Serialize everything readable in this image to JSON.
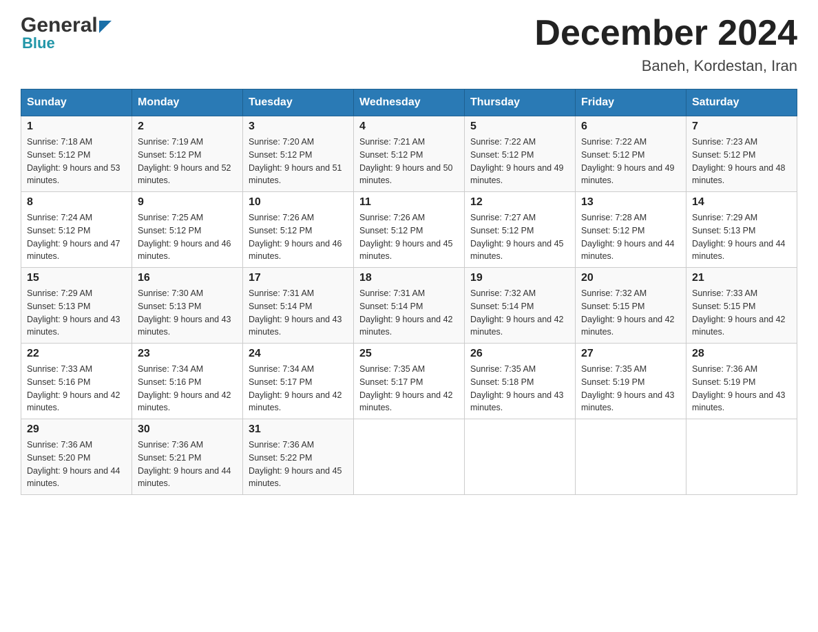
{
  "logo": {
    "top": "General",
    "bottom": "Blue",
    "aria": "GeneralBlue logo"
  },
  "header": {
    "month_year": "December 2024",
    "location": "Baneh, Kordestan, Iran"
  },
  "columns": [
    "Sunday",
    "Monday",
    "Tuesday",
    "Wednesday",
    "Thursday",
    "Friday",
    "Saturday"
  ],
  "weeks": [
    [
      {
        "day": "1",
        "sunrise": "Sunrise: 7:18 AM",
        "sunset": "Sunset: 5:12 PM",
        "daylight": "Daylight: 9 hours and 53 minutes."
      },
      {
        "day": "2",
        "sunrise": "Sunrise: 7:19 AM",
        "sunset": "Sunset: 5:12 PM",
        "daylight": "Daylight: 9 hours and 52 minutes."
      },
      {
        "day": "3",
        "sunrise": "Sunrise: 7:20 AM",
        "sunset": "Sunset: 5:12 PM",
        "daylight": "Daylight: 9 hours and 51 minutes."
      },
      {
        "day": "4",
        "sunrise": "Sunrise: 7:21 AM",
        "sunset": "Sunset: 5:12 PM",
        "daylight": "Daylight: 9 hours and 50 minutes."
      },
      {
        "day": "5",
        "sunrise": "Sunrise: 7:22 AM",
        "sunset": "Sunset: 5:12 PM",
        "daylight": "Daylight: 9 hours and 49 minutes."
      },
      {
        "day": "6",
        "sunrise": "Sunrise: 7:22 AM",
        "sunset": "Sunset: 5:12 PM",
        "daylight": "Daylight: 9 hours and 49 minutes."
      },
      {
        "day": "7",
        "sunrise": "Sunrise: 7:23 AM",
        "sunset": "Sunset: 5:12 PM",
        "daylight": "Daylight: 9 hours and 48 minutes."
      }
    ],
    [
      {
        "day": "8",
        "sunrise": "Sunrise: 7:24 AM",
        "sunset": "Sunset: 5:12 PM",
        "daylight": "Daylight: 9 hours and 47 minutes."
      },
      {
        "day": "9",
        "sunrise": "Sunrise: 7:25 AM",
        "sunset": "Sunset: 5:12 PM",
        "daylight": "Daylight: 9 hours and 46 minutes."
      },
      {
        "day": "10",
        "sunrise": "Sunrise: 7:26 AM",
        "sunset": "Sunset: 5:12 PM",
        "daylight": "Daylight: 9 hours and 46 minutes."
      },
      {
        "day": "11",
        "sunrise": "Sunrise: 7:26 AM",
        "sunset": "Sunset: 5:12 PM",
        "daylight": "Daylight: 9 hours and 45 minutes."
      },
      {
        "day": "12",
        "sunrise": "Sunrise: 7:27 AM",
        "sunset": "Sunset: 5:12 PM",
        "daylight": "Daylight: 9 hours and 45 minutes."
      },
      {
        "day": "13",
        "sunrise": "Sunrise: 7:28 AM",
        "sunset": "Sunset: 5:12 PM",
        "daylight": "Daylight: 9 hours and 44 minutes."
      },
      {
        "day": "14",
        "sunrise": "Sunrise: 7:29 AM",
        "sunset": "Sunset: 5:13 PM",
        "daylight": "Daylight: 9 hours and 44 minutes."
      }
    ],
    [
      {
        "day": "15",
        "sunrise": "Sunrise: 7:29 AM",
        "sunset": "Sunset: 5:13 PM",
        "daylight": "Daylight: 9 hours and 43 minutes."
      },
      {
        "day": "16",
        "sunrise": "Sunrise: 7:30 AM",
        "sunset": "Sunset: 5:13 PM",
        "daylight": "Daylight: 9 hours and 43 minutes."
      },
      {
        "day": "17",
        "sunrise": "Sunrise: 7:31 AM",
        "sunset": "Sunset: 5:14 PM",
        "daylight": "Daylight: 9 hours and 43 minutes."
      },
      {
        "day": "18",
        "sunrise": "Sunrise: 7:31 AM",
        "sunset": "Sunset: 5:14 PM",
        "daylight": "Daylight: 9 hours and 42 minutes."
      },
      {
        "day": "19",
        "sunrise": "Sunrise: 7:32 AM",
        "sunset": "Sunset: 5:14 PM",
        "daylight": "Daylight: 9 hours and 42 minutes."
      },
      {
        "day": "20",
        "sunrise": "Sunrise: 7:32 AM",
        "sunset": "Sunset: 5:15 PM",
        "daylight": "Daylight: 9 hours and 42 minutes."
      },
      {
        "day": "21",
        "sunrise": "Sunrise: 7:33 AM",
        "sunset": "Sunset: 5:15 PM",
        "daylight": "Daylight: 9 hours and 42 minutes."
      }
    ],
    [
      {
        "day": "22",
        "sunrise": "Sunrise: 7:33 AM",
        "sunset": "Sunset: 5:16 PM",
        "daylight": "Daylight: 9 hours and 42 minutes."
      },
      {
        "day": "23",
        "sunrise": "Sunrise: 7:34 AM",
        "sunset": "Sunset: 5:16 PM",
        "daylight": "Daylight: 9 hours and 42 minutes."
      },
      {
        "day": "24",
        "sunrise": "Sunrise: 7:34 AM",
        "sunset": "Sunset: 5:17 PM",
        "daylight": "Daylight: 9 hours and 42 minutes."
      },
      {
        "day": "25",
        "sunrise": "Sunrise: 7:35 AM",
        "sunset": "Sunset: 5:17 PM",
        "daylight": "Daylight: 9 hours and 42 minutes."
      },
      {
        "day": "26",
        "sunrise": "Sunrise: 7:35 AM",
        "sunset": "Sunset: 5:18 PM",
        "daylight": "Daylight: 9 hours and 43 minutes."
      },
      {
        "day": "27",
        "sunrise": "Sunrise: 7:35 AM",
        "sunset": "Sunset: 5:19 PM",
        "daylight": "Daylight: 9 hours and 43 minutes."
      },
      {
        "day": "28",
        "sunrise": "Sunrise: 7:36 AM",
        "sunset": "Sunset: 5:19 PM",
        "daylight": "Daylight: 9 hours and 43 minutes."
      }
    ],
    [
      {
        "day": "29",
        "sunrise": "Sunrise: 7:36 AM",
        "sunset": "Sunset: 5:20 PM",
        "daylight": "Daylight: 9 hours and 44 minutes."
      },
      {
        "day": "30",
        "sunrise": "Sunrise: 7:36 AM",
        "sunset": "Sunset: 5:21 PM",
        "daylight": "Daylight: 9 hours and 44 minutes."
      },
      {
        "day": "31",
        "sunrise": "Sunrise: 7:36 AM",
        "sunset": "Sunset: 5:22 PM",
        "daylight": "Daylight: 9 hours and 45 minutes."
      },
      null,
      null,
      null,
      null
    ]
  ]
}
